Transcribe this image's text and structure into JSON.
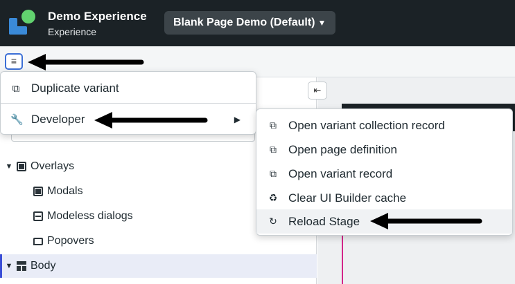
{
  "header": {
    "app_title": "Demo Experience",
    "app_subtitle": "Experience",
    "page_selector": "Blank Page Demo (Default)"
  },
  "toolbar": {
    "menu_icon": "hamburger-icon",
    "collapse_icon": "panel-collapse-icon"
  },
  "menu": {
    "items": [
      {
        "label": "Duplicate variant",
        "icon": "copy-icon"
      },
      {
        "label": "Developer",
        "icon": "wrench-icon"
      }
    ]
  },
  "submenu": {
    "items": [
      {
        "label": "Open variant collection record",
        "icon": "external-link-icon"
      },
      {
        "label": "Open page definition",
        "icon": "external-link-icon"
      },
      {
        "label": "Open variant record",
        "icon": "external-link-icon"
      },
      {
        "label": "Clear UI Builder cache",
        "icon": "recycle-icon"
      },
      {
        "label": "Reload Stage",
        "icon": "reload-icon"
      }
    ]
  },
  "tree": {
    "items": [
      {
        "label": "Overlays",
        "icon": "container-icon"
      },
      {
        "label": "Modals",
        "icon": "modal-icon"
      },
      {
        "label": "Modeless dialogs",
        "icon": "modeless-dialog-icon"
      },
      {
        "label": "Popovers",
        "icon": "popover-icon"
      },
      {
        "label": "Body",
        "icon": "body-layout-icon"
      }
    ]
  },
  "colors": {
    "header_bg": "#1b2226",
    "accent": "#3b6fd6",
    "selected_row_bg": "#e9ecf7",
    "stage_highlight": "#d3268a"
  }
}
